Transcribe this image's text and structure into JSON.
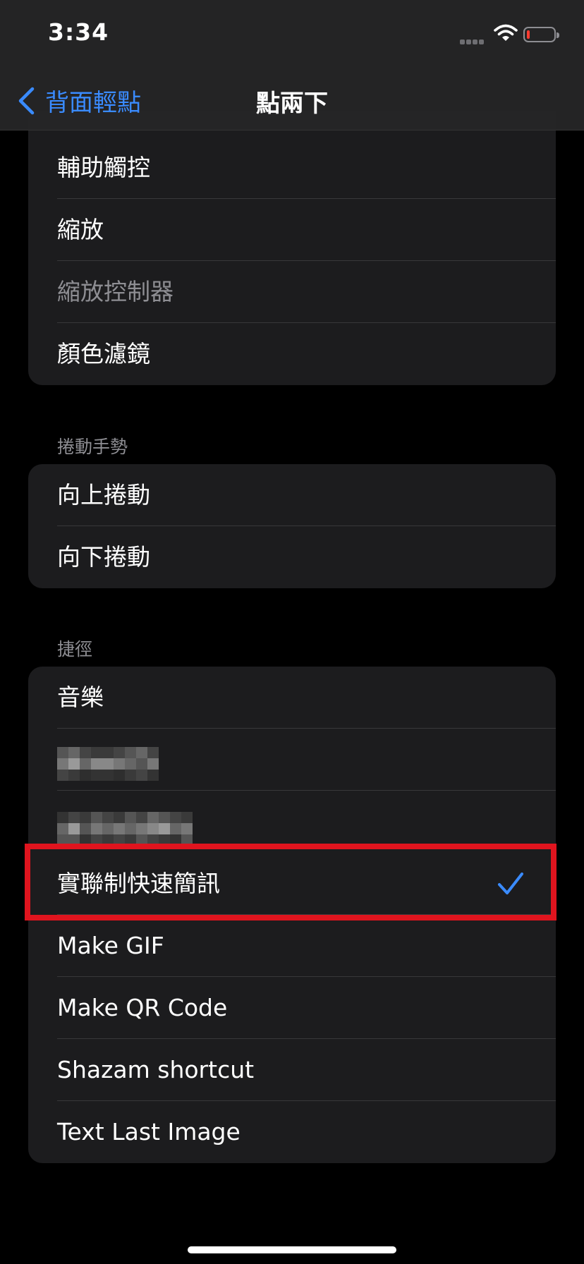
{
  "status": {
    "time": "3:34"
  },
  "nav": {
    "back_label": "背面輕點",
    "title": "點兩下"
  },
  "group1": {
    "items": [
      "輔助觸控",
      "縮放",
      "縮放控制器",
      "顏色濾鏡"
    ]
  },
  "section2": {
    "header": "捲動手勢",
    "items": [
      "向上捲動",
      "向下捲動"
    ]
  },
  "section3": {
    "header": "捷徑",
    "items": [
      "音樂",
      "",
      "",
      "實聯制快速簡訊",
      "Make GIF",
      "Make QR Code",
      "Shazam shortcut",
      "Text Last Image"
    ],
    "selected": "實聯制快速簡訊"
  },
  "colors": {
    "accent": "#3a8bff",
    "highlight": "#e0141e",
    "cell": "#1c1c1e"
  },
  "icons": [
    "back-chevron-icon",
    "wifi-icon",
    "battery-icon",
    "cellular-signal-icon",
    "checkmark-icon"
  ]
}
